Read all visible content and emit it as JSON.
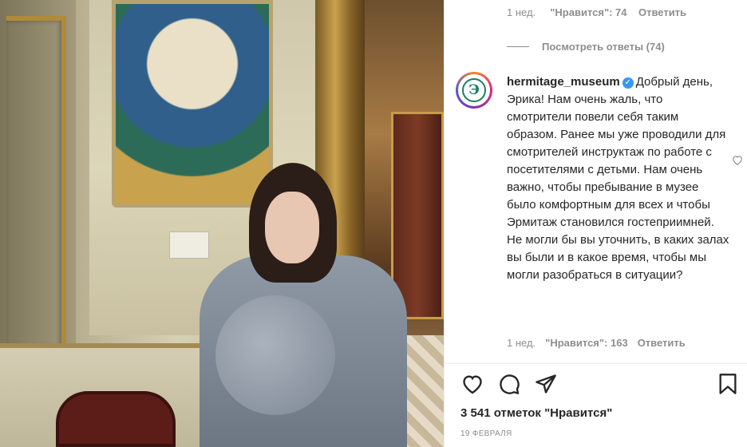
{
  "previous_reply": {
    "time": "1 нед.",
    "likes": "\"Нравится\": 74",
    "reply": "Ответить"
  },
  "view_replies": "Посмотреть ответы (74)",
  "comment": {
    "avatar_logo": "Э",
    "username": "hermitage_museum",
    "text": "Добрый день, Эрика! Нам очень жаль, что смотрители повели себя таким образом. Ранее мы уже проводили для смотрителей инструктаж по работе с посетителями с детьми. Нам очень важно, чтобы пребывание в музее было комфортным для всех и чтобы Эрмитаж становился гостеприимней. Не могли бы вы уточнить, в каких залах вы были и в какое время, чтобы мы могли разобраться в ситуации?",
    "time": "1 нед.",
    "likes": "\"Нравится\": 163",
    "reply": "Ответить",
    "like_icon": "heart-outline-icon"
  },
  "actions": {
    "like_icon": "heart-icon",
    "comment_icon": "comment-icon",
    "share_icon": "share-icon",
    "save_icon": "bookmark-icon"
  },
  "likes_total": "3 541 отметок \"Нравится\"",
  "post_date": "19 февраля",
  "colors": {
    "accent_blue": "#3897f0",
    "text": "#262626",
    "muted": "#8e8e8e",
    "logo_green": "#17805a"
  }
}
